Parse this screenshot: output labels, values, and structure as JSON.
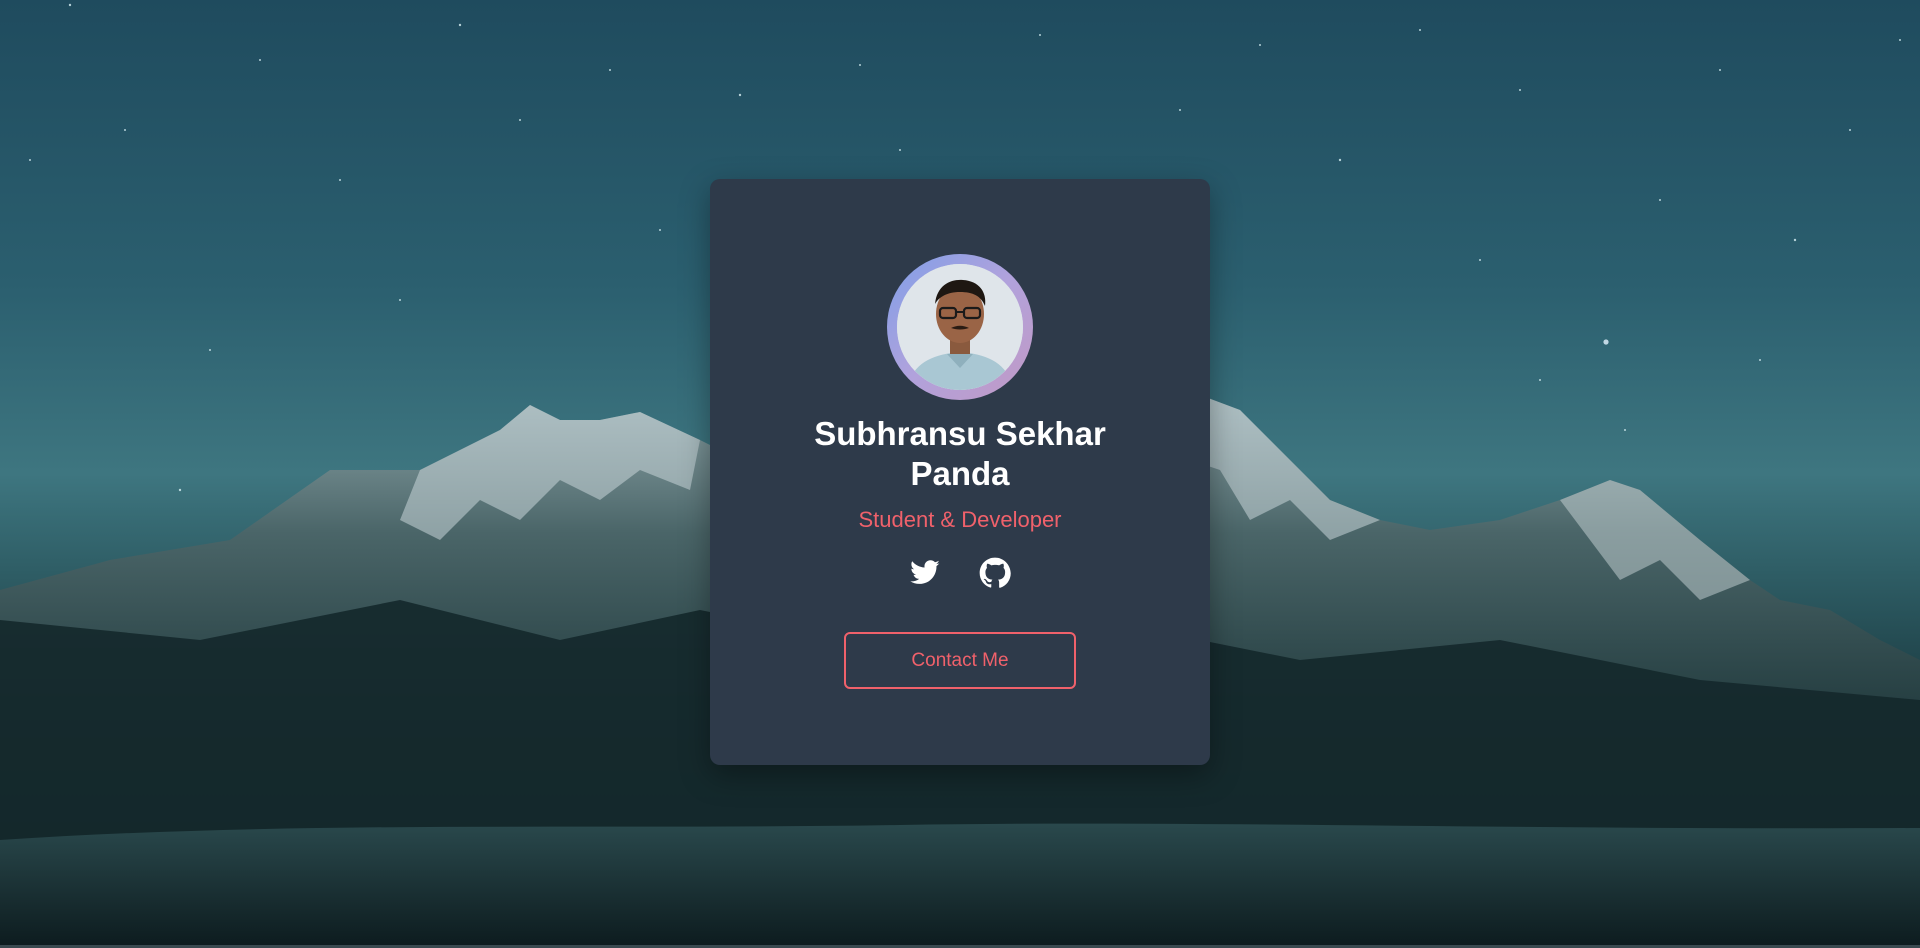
{
  "profile": {
    "name_line1": "Subhransu Sekhar",
    "name_line2": "Panda",
    "role": "Student & Developer",
    "avatar_alt": "Profile photo"
  },
  "socials": [
    {
      "icon": "twitter-icon"
    },
    {
      "icon": "github-icon"
    }
  ],
  "contact_button": {
    "label": "Contact Me"
  },
  "colors": {
    "card_background": "#2e3a4a",
    "accent": "#f0616b",
    "name_text": "#ffffff",
    "avatar_ring_start": "#7f9fe8",
    "avatar_ring_end": "#c299c4"
  }
}
